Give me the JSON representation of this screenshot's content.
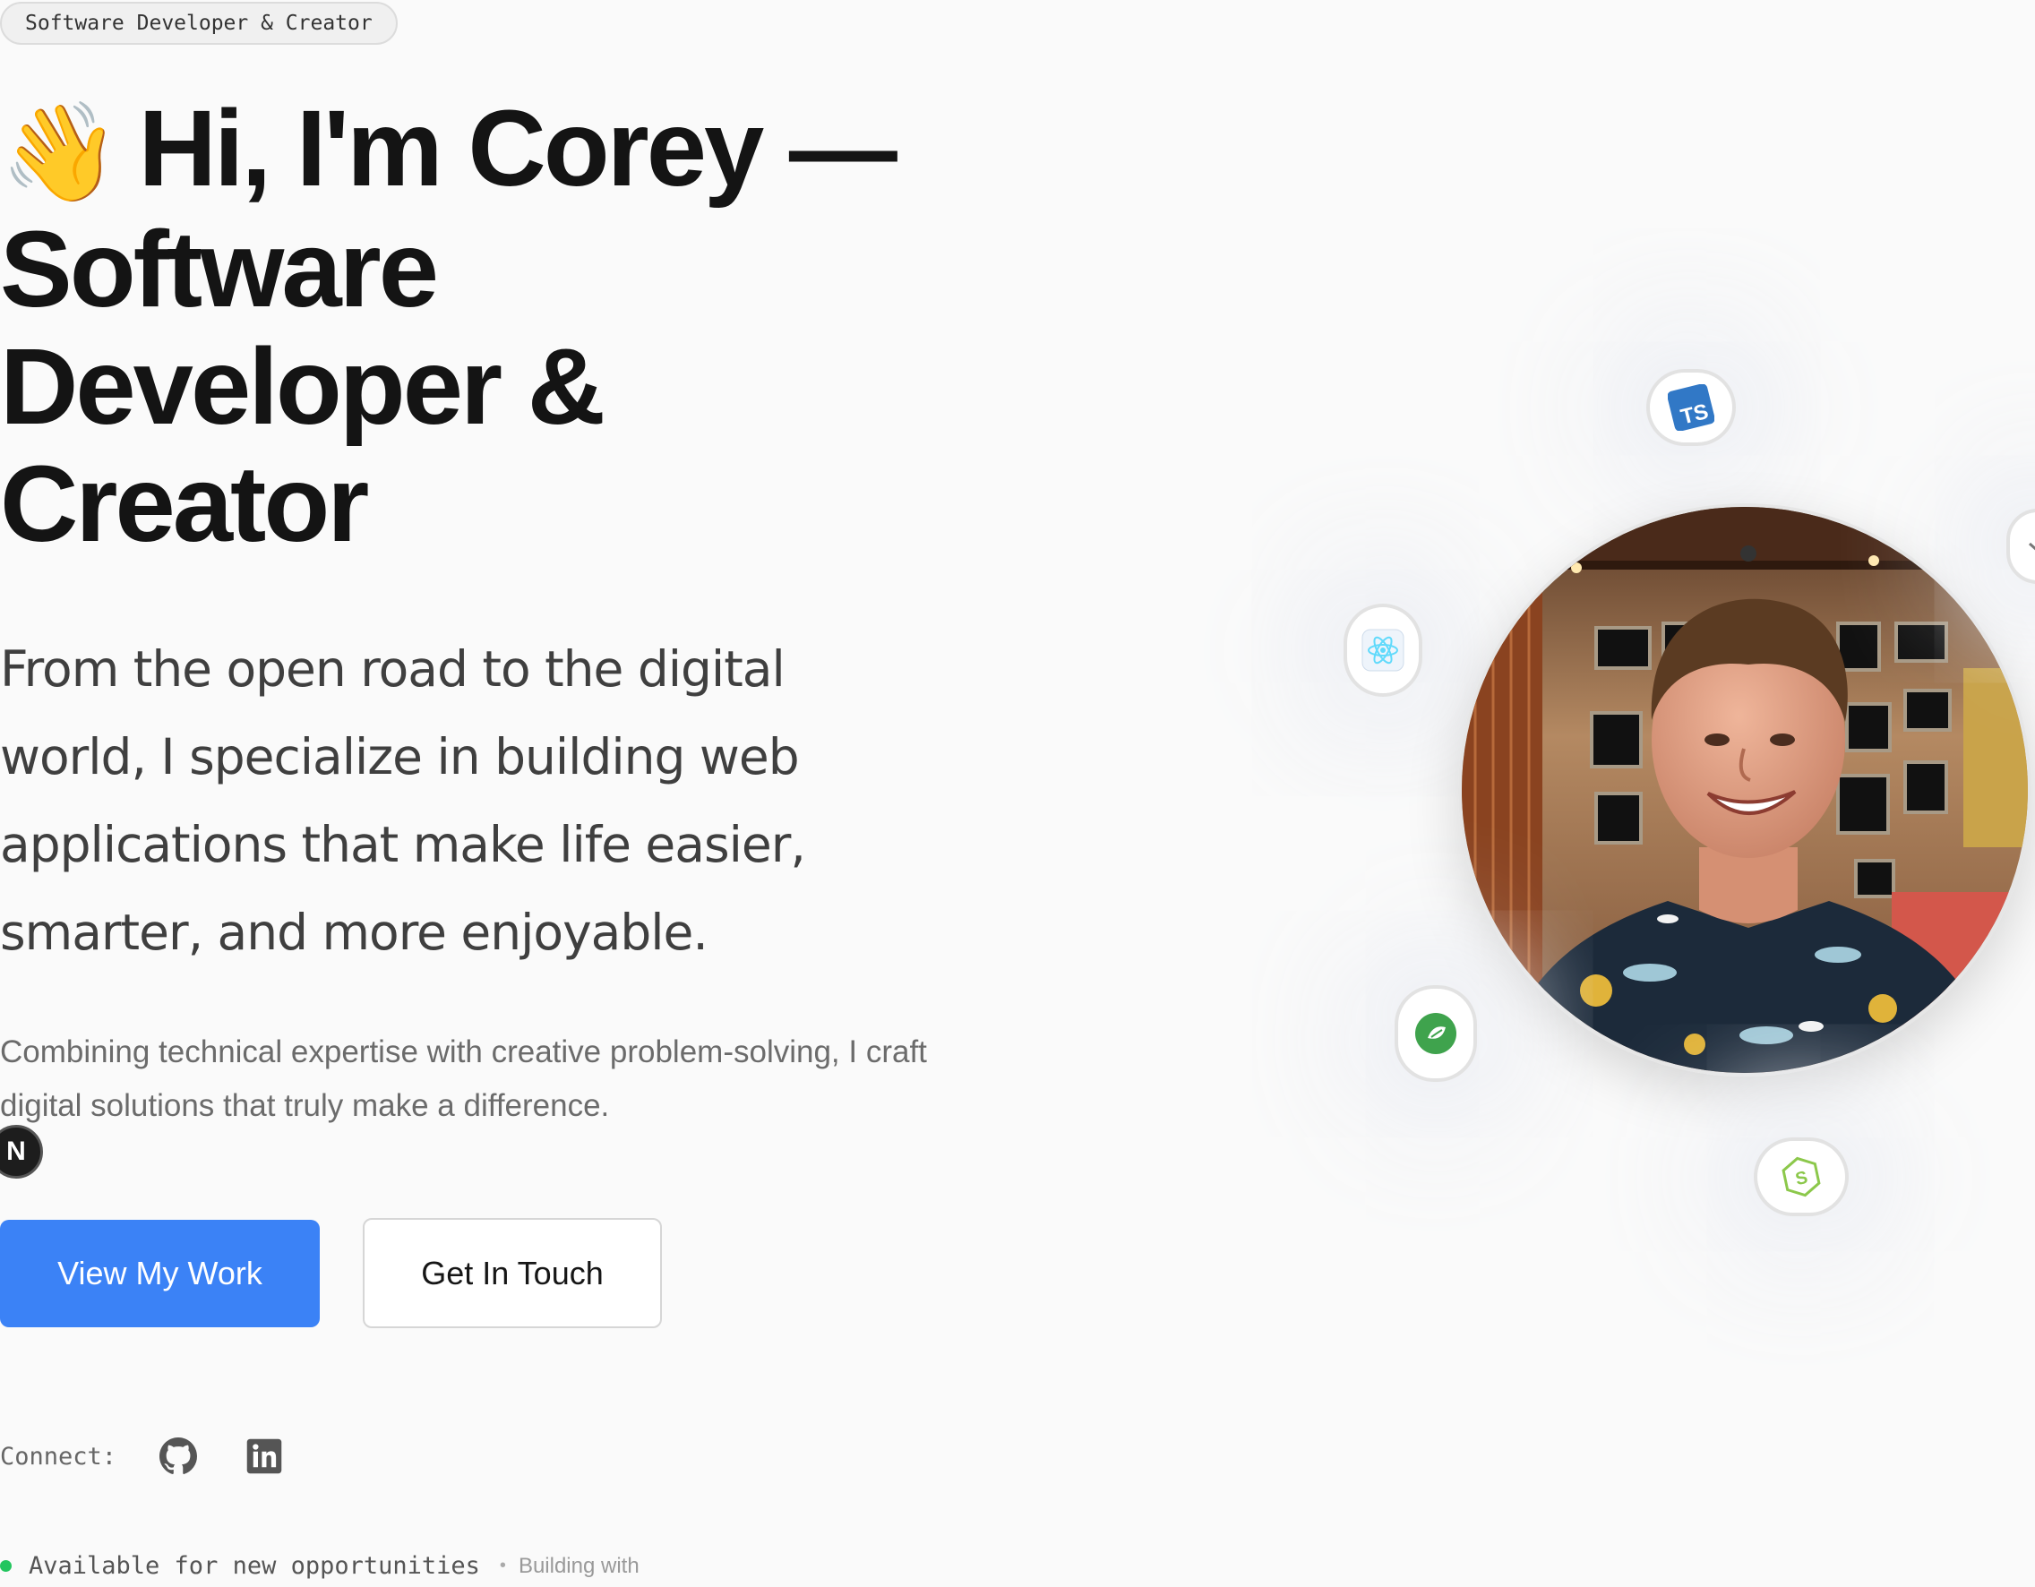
{
  "badge": "Software Developer & Creator",
  "heading": {
    "emoji": "👋",
    "line1": "Hi, I'm Corey —",
    "line2": "Software",
    "line3": "Developer &",
    "line4": "Creator"
  },
  "lead": "From the open road to the digital world, I specialize in building web applications that make life easier, smarter, and more enjoyable.",
  "subtext": "Combining technical expertise with creative problem-solving, I craft digital solutions that truly make a difference.",
  "n_badge": "N",
  "buttons": {
    "primary": "View My Work",
    "secondary": "Get In Touch"
  },
  "connect": {
    "label": "Connect:",
    "links": [
      "github-icon",
      "linkedin-icon"
    ]
  },
  "status": {
    "text": "Available for new opportunities",
    "separator": "•",
    "extra": "Building with"
  },
  "tech_icons": [
    "typescript-icon",
    "react-icon",
    "mongodb-icon",
    "nodejs-icon"
  ],
  "colors": {
    "accent": "#3b82f6",
    "status": "#22c55e",
    "typescript": "#3178c6",
    "react": "#61dafb",
    "mongodb": "#3fa34d",
    "nodejs": "#8cc84b"
  }
}
